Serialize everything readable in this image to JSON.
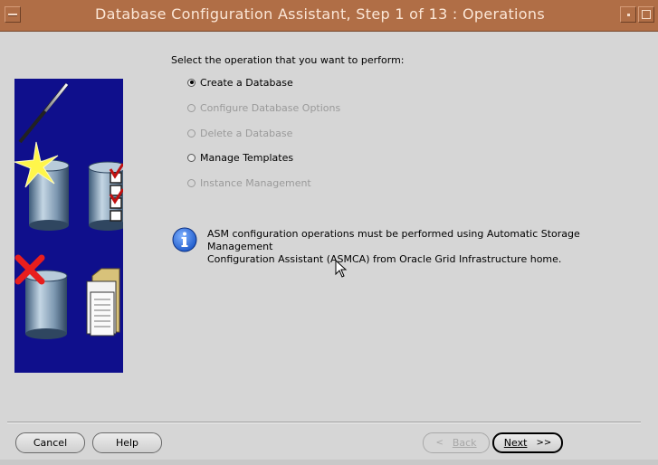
{
  "window": {
    "title": "Database Configuration Assistant, Step 1 of 13 : Operations"
  },
  "prompt": "Select the operation that you want to perform:",
  "operations": [
    {
      "label": "Create a Database",
      "selected": true,
      "enabled": true
    },
    {
      "label": "Configure Database Options",
      "selected": false,
      "enabled": false
    },
    {
      "label": "Delete a Database",
      "selected": false,
      "enabled": false
    },
    {
      "label": "Manage Templates",
      "selected": false,
      "enabled": true
    },
    {
      "label": "Instance Management",
      "selected": false,
      "enabled": false
    }
  ],
  "info": {
    "line1": "ASM configuration operations must be performed using Automatic Storage Management",
    "line2": "Configuration Assistant (ASMCA) from Oracle Grid Infrastructure home."
  },
  "buttons": {
    "cancel": "Cancel",
    "help": "Help",
    "back": "Back",
    "next": "Next"
  },
  "colors": {
    "title_bar": "#b06e46",
    "art_background": "#0f0f8c"
  }
}
